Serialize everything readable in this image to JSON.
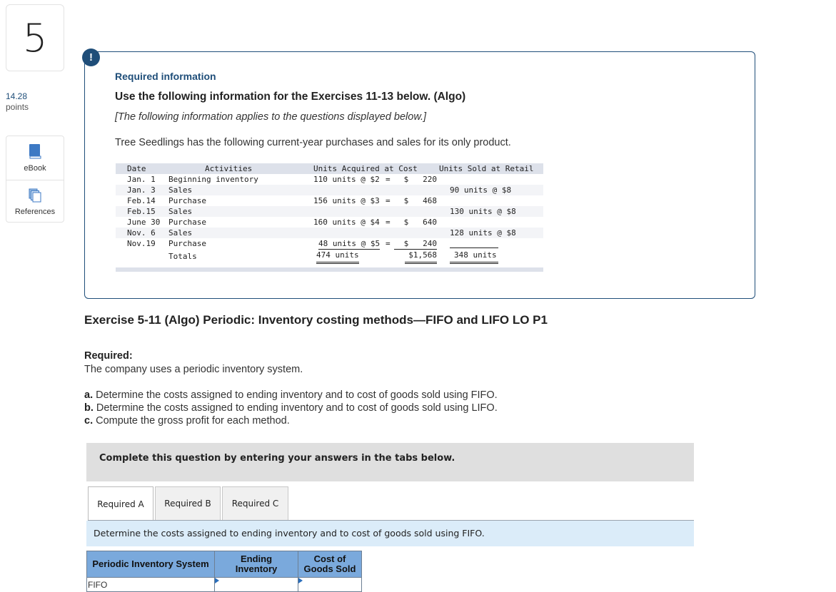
{
  "question": {
    "number": "5",
    "points_value": "14.28",
    "points_label": "points"
  },
  "tools": [
    {
      "label": "eBook",
      "icon": "book-icon"
    },
    {
      "label": "References",
      "icon": "documents-icon"
    }
  ],
  "info": {
    "badge": "!",
    "heading": "Required information",
    "title": "Use the following information for the Exercises 11-13 below. (Algo)",
    "applies": "[The following information applies to the questions displayed below.]",
    "intro": "Tree Seedlings has the following current-year purchases and sales for its only product."
  },
  "ledger": {
    "headers": {
      "date": "Date",
      "activities": "Activities",
      "acquired": "Units Acquired at Cost",
      "sold": "Units Sold at Retail"
    },
    "rows": [
      {
        "date": "Jan. 1",
        "activity": "Beginning inventory",
        "acquired": "110 units @ $2",
        "eq": "=",
        "amount": "$   220",
        "sold": ""
      },
      {
        "date": "Jan. 3",
        "activity": "Sales",
        "acquired": "",
        "eq": "",
        "amount": "",
        "sold": "90 units @ $8"
      },
      {
        "date": "Feb.14",
        "activity": "Purchase",
        "acquired": "156 units @ $3",
        "eq": "=",
        "amount": "$   468",
        "sold": ""
      },
      {
        "date": "Feb.15",
        "activity": "Sales",
        "acquired": "",
        "eq": "",
        "amount": "",
        "sold": "130 units @ $8"
      },
      {
        "date": "June 30",
        "activity": "Purchase",
        "acquired": "160 units @ $4",
        "eq": "=",
        "amount": "$   640",
        "sold": ""
      },
      {
        "date": "Nov. 6",
        "activity": "Sales",
        "acquired": "",
        "eq": "",
        "amount": "",
        "sold": "128 units @ $8"
      },
      {
        "date": "Nov.19",
        "activity": "Purchase",
        "acquired": "48 units @ $5",
        "eq": "=",
        "amount": "$   240",
        "sold": ""
      }
    ],
    "totals": {
      "label": "Totals",
      "units_acquired": "474 units",
      "cost": "$1,568",
      "units_sold": "348 units"
    }
  },
  "exercise": {
    "title": "Exercise 5-11 (Algo) Periodic: Inventory costing methods—FIFO and LIFO LO P1",
    "required_heading": "Required:",
    "required_text": "The company uses a periodic inventory system.",
    "tasks": [
      {
        "letter": "a.",
        "text": " Determine the costs assigned to ending inventory and to cost of goods sold using FIFO."
      },
      {
        "letter": "b.",
        "text": " Determine the costs assigned to ending inventory and to cost of goods sold using LIFO."
      },
      {
        "letter": "c.",
        "text": " Compute the gross profit for each method."
      }
    ]
  },
  "answer_area": {
    "banner": "Complete this question by entering your answers in the tabs below.",
    "tabs": [
      {
        "label": "Required A",
        "active": true
      },
      {
        "label": "Required B",
        "active": false
      },
      {
        "label": "Required C",
        "active": false
      }
    ],
    "instruction": "Determine the costs assigned to ending inventory and to cost of goods sold using FIFO.",
    "table": {
      "headers": [
        "Periodic Inventory System",
        "Ending Inventory",
        "Cost of Goods Sold"
      ],
      "rows": [
        {
          "label": "FIFO",
          "ending_inventory": "",
          "cogs": ""
        }
      ]
    }
  },
  "colors": {
    "accent": "#1f4e79",
    "table_header": "#7aa9dc",
    "instruction_bg": "#dbecf9",
    "banner_bg": "#dfdfdf"
  }
}
